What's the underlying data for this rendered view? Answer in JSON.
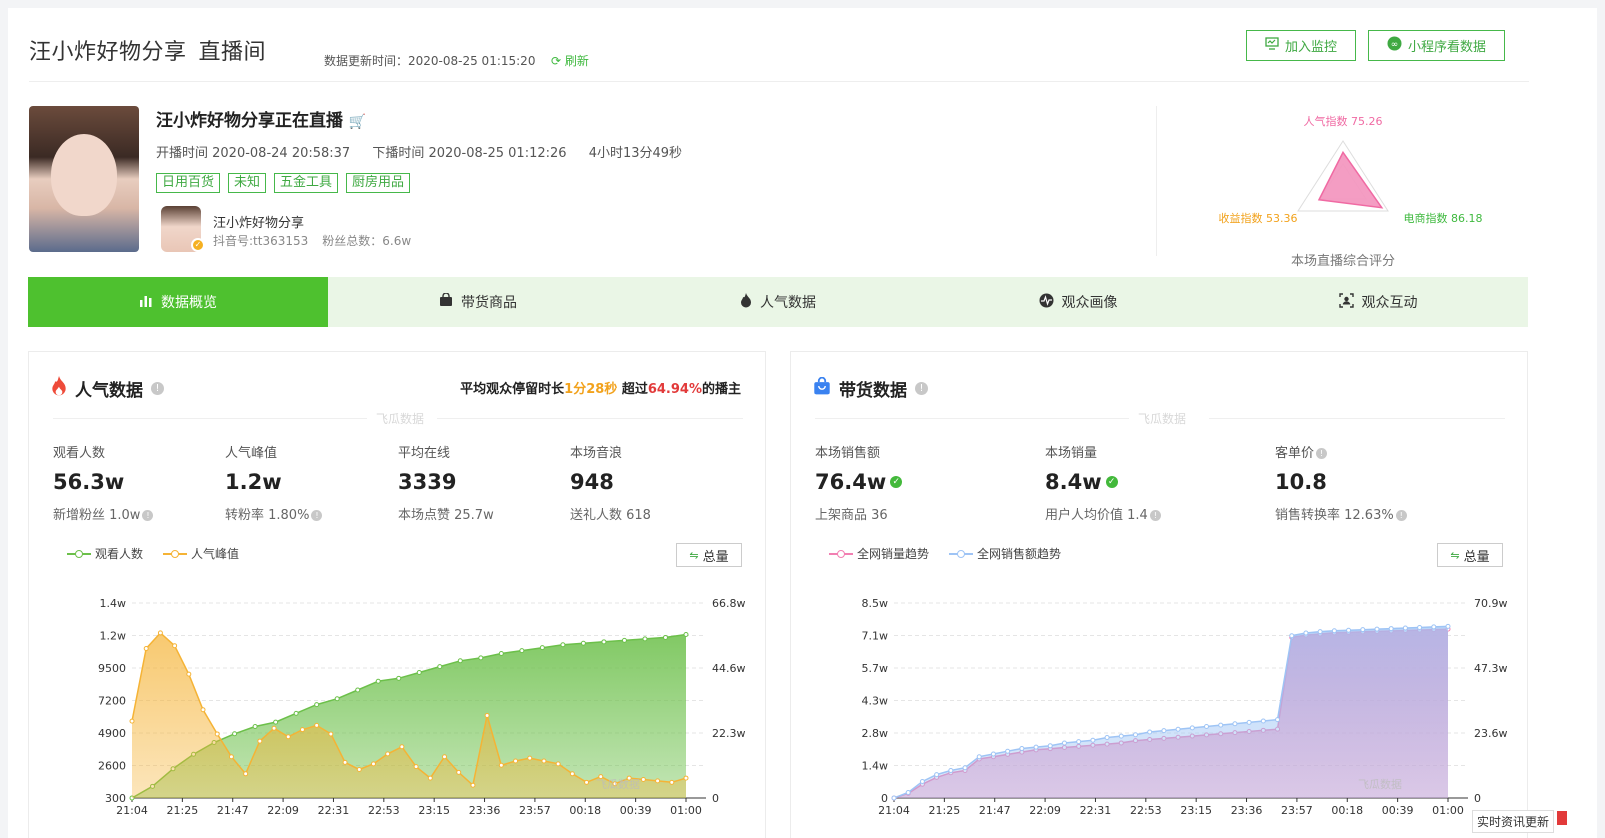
{
  "header": {
    "title": "汪小炸好物分享",
    "subtitle": "直播间",
    "update_label": "数据更新时间：2020-08-25 01:15:20",
    "refresh_label": "刷新",
    "monitor_btn": "加入监控",
    "miniapp_btn": "小程序看数据"
  },
  "live": {
    "title": "汪小炸好物分享正在直播",
    "start": "开播时间 2020-08-24 20:58:37",
    "end": "下播时间 2020-08-25 01:12:26",
    "duration": "4小时13分49秒",
    "tags": [
      "日用百货",
      "未知",
      "五金工具",
      "厨房用品"
    ],
    "anchor_name": "汪小炸好物分享",
    "douyin_id": "抖音号:tt363153",
    "fans": "粉丝总数：6.6w"
  },
  "score": {
    "popularity": "人气指数 75.26",
    "income": "收益指数 53.36",
    "ecommerce": "电商指数 86.18",
    "caption": "本场直播综合评分",
    "values": {
      "popularity": 75.26,
      "income": 53.36,
      "ecommerce": 86.18
    }
  },
  "tabs": [
    "数据概览",
    "带货商品",
    "人气数据",
    "观众画像",
    "观众互动"
  ],
  "popularity_card": {
    "title": "人气数据",
    "retain_prefix": "平均观众停留时长",
    "retain_time": "1分28秒",
    "retain_mid": " 超过",
    "retain_pct": "64.94%",
    "retain_suffix": "的播主",
    "watermark": "飞瓜数据",
    "stats": [
      {
        "label": "观看人数",
        "value": "56.3w",
        "sub": "新增粉丝 1.0w"
      },
      {
        "label": "人气峰值",
        "value": "1.2w",
        "sub": "转粉率 1.80%"
      },
      {
        "label": "平均在线",
        "value": "3339",
        "sub": "本场点赞 25.7w"
      },
      {
        "label": "本场音浪",
        "value": "948",
        "sub": "送礼人数 618"
      }
    ],
    "legend": [
      "观看人数",
      "人气峰值"
    ],
    "total_btn": "总量"
  },
  "sales_card": {
    "title": "带货数据",
    "watermark": "飞瓜数据",
    "stats": [
      {
        "label": "本场销售额",
        "value": "76.4w",
        "sub": "上架商品 36"
      },
      {
        "label": "本场销量",
        "value": "8.4w",
        "sub": "用户人均价值 1.4"
      },
      {
        "label": "客单价",
        "value": "10.8",
        "sub": "销售转换率 12.63%"
      }
    ],
    "legend": [
      "全网销量趋势",
      "全网销售额趋势"
    ],
    "total_btn": "总量"
  },
  "chart_data": [
    {
      "type": "area",
      "x": [
        "21:04",
        "21:25",
        "21:47",
        "22:09",
        "22:31",
        "22:53",
        "23:15",
        "23:36",
        "23:57",
        "00:18",
        "00:39",
        "01:00"
      ],
      "y_left_ticks": [
        "300",
        "2600",
        "4900",
        "7200",
        "9500",
        "1.2w",
        "1.4w"
      ],
      "y_right_ticks": [
        "0",
        "22.3w",
        "44.6w",
        "66.8w"
      ],
      "ylim_left": [
        300,
        14000
      ],
      "ylim_right": [
        0,
        668000
      ],
      "series": [
        {
          "name": "观看人数",
          "axis": "right",
          "color": "#6cc04a",
          "values": [
            0,
            40000,
            100000,
            150000,
            190000,
            220000,
            245000,
            260000,
            290000,
            320000,
            340000,
            370000,
            400000,
            410000,
            430000,
            450000,
            470000,
            480000,
            495000,
            505000,
            515000,
            525000,
            530000,
            535000,
            540000,
            545000,
            550000,
            560000
          ]
        },
        {
          "name": "人气峰值",
          "axis": "left",
          "color": "#f5b335",
          "values": [
            5700,
            10800,
            11900,
            11000,
            9000,
            6500,
            4800,
            3200,
            2000,
            4300,
            5200,
            4600,
            5100,
            5400,
            4800,
            2800,
            2300,
            2700,
            3400,
            3900,
            2500,
            1700,
            3200,
            2100,
            1200,
            6100,
            2600,
            2900,
            3100,
            2900,
            2700,
            2000,
            1400,
            1800,
            1300,
            1700,
            1600,
            1500,
            1400,
            1700
          ]
        }
      ]
    },
    {
      "type": "area",
      "x": [
        "21:04",
        "21:25",
        "21:47",
        "22:09",
        "22:31",
        "22:53",
        "23:15",
        "23:36",
        "23:57",
        "00:18",
        "00:39",
        "01:00"
      ],
      "y_left_ticks": [
        "0",
        "1.4w",
        "2.8w",
        "4.3w",
        "5.7w",
        "7.1w",
        "8.5w"
      ],
      "y_right_ticks": [
        "0",
        "23.6w",
        "47.3w",
        "70.9w"
      ],
      "ylim_left": [
        0,
        85000
      ],
      "ylim_right": [
        0,
        709000
      ],
      "series": [
        {
          "name": "全网销量趋势",
          "axis": "left",
          "color": "#f27fb2",
          "values": [
            0,
            2000,
            6000,
            9000,
            11000,
            12000,
            17000,
            18000,
            19000,
            20000,
            21000,
            21500,
            22000,
            22500,
            23000,
            23500,
            24000,
            25000,
            25500,
            26000,
            26500,
            27000,
            27500,
            28000,
            28500,
            29000,
            29500,
            30000,
            70000,
            71000,
            71500,
            72000,
            72200,
            72400,
            72600,
            72800,
            73000,
            73200,
            73400,
            73600
          ]
        },
        {
          "name": "全网销售额趋势",
          "axis": "right",
          "color": "#9ec4f5",
          "values": [
            0,
            20000,
            60000,
            85000,
            100000,
            110000,
            150000,
            160000,
            170000,
            180000,
            185000,
            190000,
            200000,
            205000,
            210000,
            220000,
            225000,
            230000,
            240000,
            245000,
            250000,
            255000,
            260000,
            265000,
            270000,
            275000,
            280000,
            285000,
            590000,
            600000,
            605000,
            608000,
            610000,
            612000,
            614000,
            616000,
            618000,
            620000,
            622000,
            624000
          ]
        }
      ]
    }
  ],
  "footer_tip": "实时资讯更新"
}
